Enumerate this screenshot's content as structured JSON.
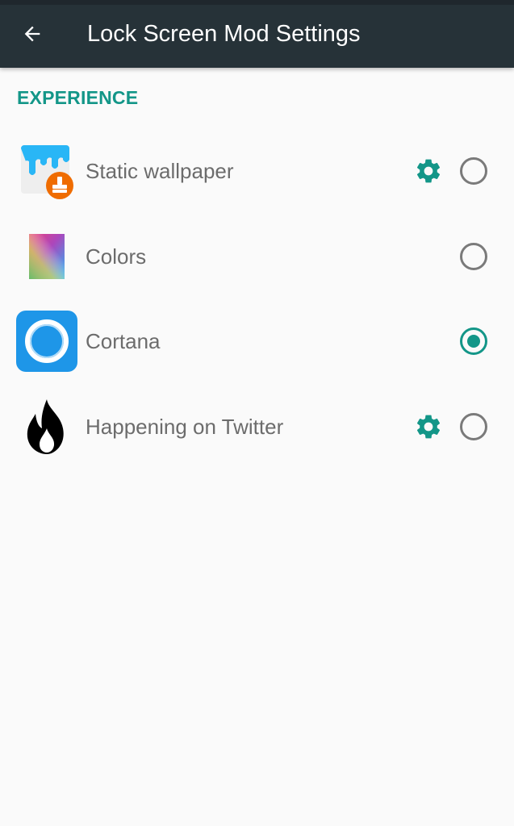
{
  "app_bar": {
    "title": "Lock Screen Mod Settings",
    "back_icon": "arrow-left-icon",
    "background": "#263238"
  },
  "section": {
    "header": "EXPERIENCE",
    "accent_color": "#139688"
  },
  "items": [
    {
      "label": "Static wallpaper",
      "icon": "static-wallpaper-app-icon",
      "has_settings": true,
      "selected": false
    },
    {
      "label": "Colors",
      "icon": "colors-gradient-icon",
      "has_settings": false,
      "selected": false
    },
    {
      "label": "Cortana",
      "icon": "cortana-app-icon",
      "has_settings": false,
      "selected": true
    },
    {
      "label": "Happening on Twitter",
      "icon": "flame-icon",
      "has_settings": true,
      "selected": false
    }
  ]
}
